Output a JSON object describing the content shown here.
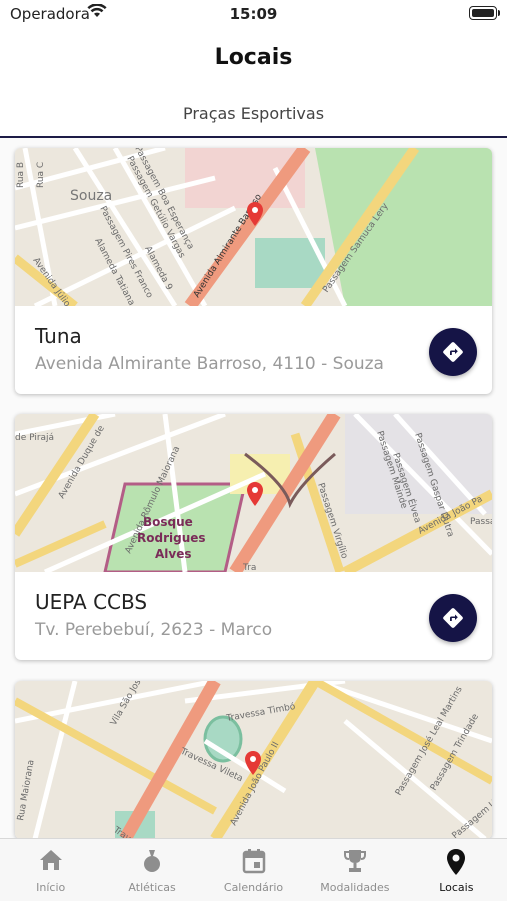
{
  "status": {
    "carrier": "Operadora",
    "time": "15:09"
  },
  "header": {
    "title": "Locais",
    "subtitle": "Praças Esportivas"
  },
  "places": [
    {
      "name": "Tuna",
      "address": "Avenida Almirante Barroso, 4110 - Souza",
      "map_labels": [
        "Souza",
        "Avenida Almirante Barroso",
        "Passagem Samuca Lery",
        "Passagem Getúlio Vargas",
        "Passagem Pires Franco",
        "Alameda Tatiana",
        "Alameda 9",
        "Passagem Boa Esperança",
        "Rua B",
        "Rua C",
        "Avenida Júlio"
      ]
    },
    {
      "name": "UEPA CCBS",
      "address": "Tv. Perebebuí, 2623 - Marco",
      "map_labels": [
        "Bosque",
        "Rodrigues",
        "Alves",
        "Avenida Duque de",
        "Avenida Rômulo Maiorana",
        "Avenida João Pa",
        "Passagem Virgílio",
        "Passagem Gaspar Dutra",
        "Passagem Élvea",
        "Passagem Mainde",
        "de Pirajá",
        "Tra",
        "Passa"
      ]
    },
    {
      "name": "",
      "address": "",
      "map_labels": [
        "Travessa Timbó",
        "Travessa Vileta",
        "Avenida João Paulo II",
        "Vila São Jose",
        "Passagem José Leal Martins",
        "Passagem Trindade",
        "Rua Maiorana",
        "Travessa",
        "Passagem União"
      ]
    }
  ],
  "tabs": [
    {
      "label": "Início",
      "icon": "home-icon"
    },
    {
      "label": "Atléticas",
      "icon": "medal-icon"
    },
    {
      "label": "Calendário",
      "icon": "calendar-icon"
    },
    {
      "label": "Modalidades",
      "icon": "trophy-icon"
    },
    {
      "label": "Locais",
      "icon": "location-pin-icon",
      "active": true
    }
  ],
  "colors": {
    "accent": "#151446",
    "pin": "#e53935",
    "avenue": "#ef9a7e",
    "secondary_road": "#f3d67d",
    "park": "#b9e2b0"
  }
}
